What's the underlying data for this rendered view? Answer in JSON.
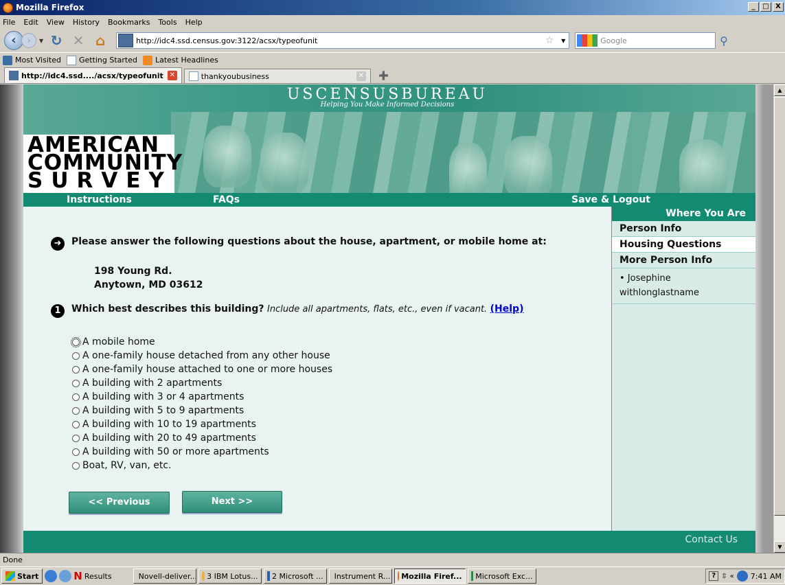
{
  "window": {
    "title": "Mozilla Firefox",
    "controls": [
      "_",
      "□",
      "X"
    ]
  },
  "menu": [
    "File",
    "Edit",
    "View",
    "History",
    "Bookmarks",
    "Tools",
    "Help"
  ],
  "nav": {
    "url": "http://idc4.ssd.census.gov:3122/acsx/typeofunit",
    "search_placeholder": "Google"
  },
  "bookmarks": [
    "Most Visited",
    "Getting Started",
    "Latest Headlines"
  ],
  "tabs": [
    {
      "label": "http://idc4.ssd..../acsx/typeofunit",
      "active": true
    },
    {
      "label": "thankyoubusiness",
      "active": false
    }
  ],
  "banner": {
    "bureau": "USCENSUSBUREAU",
    "tagline": "Helping You Make Informed Decisions",
    "logo_lines": [
      "AMERICAN",
      "COMMUNITY",
      "SURVEY"
    ]
  },
  "topnav": {
    "instructions": "Instructions",
    "faqs": "FAQs",
    "save_logout": "Save & Logout"
  },
  "sidebar": {
    "heading": "Where You Are",
    "items": [
      "Person Info",
      "Housing Questions",
      "More Person Info"
    ],
    "person_lines": [
      "• Josephine",
      "withlonglastname"
    ]
  },
  "content": {
    "intro": "Please answer the following questions about the house, apartment, or mobile home at:",
    "address_line1": "198 Young Rd.",
    "address_line2": "Anytown, MD 03612",
    "question_number": "1",
    "question_bold": "Which best describes this building?",
    "question_italic": "Include all apartments, flats, etc., even if vacant.",
    "help_link": "(Help)",
    "options": [
      "A mobile home",
      "A one-family house detached from any other house",
      "A one-family house attached to one or more houses",
      "A building with 2 apartments",
      "A building with 3 or 4 apartments",
      "A building with 5 to 9 apartments",
      "A building with 10 to 19 apartments",
      "A building with 20 to 49 apartments",
      "A building with 50 or more apartments",
      "Boat, RV, van, etc."
    ],
    "prev_button": "<<   Previous",
    "next_button": "Next   >>"
  },
  "footer": {
    "contact": "Contact Us"
  },
  "status": "Done",
  "taskbar": {
    "start": "Start",
    "results": "Results",
    "tasks": [
      "Novell-deliver...",
      "3 IBM Lotus...",
      "2 Microsoft ...",
      "Instrument R...",
      "Mozilla Firef...",
      "Microsoft Exc..."
    ],
    "active_task_index": 4,
    "clock": "7:41 AM"
  },
  "colors": {
    "census_green": "#138a72",
    "content_bg": "#e9f3f1",
    "sidebar_bg": "#d9ebe6",
    "help_link": "#0000cc"
  }
}
